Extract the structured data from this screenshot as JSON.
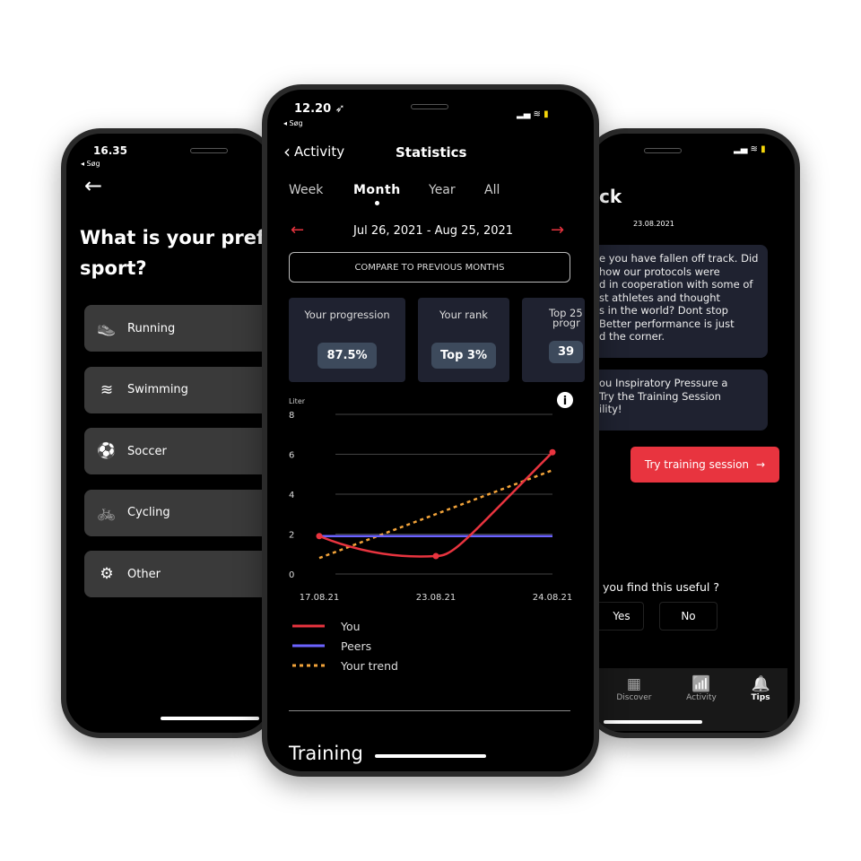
{
  "left_phone": {
    "time": "16.35",
    "back_app": "◂ Søg",
    "title_line1": "What is your pref",
    "title_line2": "sport?",
    "sports": [
      {
        "label": "Running",
        "icon": "running-shoe-icon",
        "glyph": "👟"
      },
      {
        "label": "Swimming",
        "icon": "swimmer-icon",
        "glyph": "≋"
      },
      {
        "label": "Soccer",
        "icon": "soccer-ball-icon",
        "glyph": "⚽"
      },
      {
        "label": "Cycling",
        "icon": "bicycle-icon",
        "glyph": "🚲"
      },
      {
        "label": "Other",
        "icon": "other-sports-icon",
        "glyph": "⚙"
      }
    ]
  },
  "center_phone": {
    "time": "12.20",
    "back_app": "◂ Søg",
    "back_label": "Activity",
    "title": "Statistics",
    "tabs": [
      {
        "label": "Week"
      },
      {
        "label": "Month",
        "active": true
      },
      {
        "label": "Year"
      },
      {
        "label": "All"
      }
    ],
    "date_range": "Jul 26, 2021 - Aug 25, 2021",
    "compare_button": "COMPARE TO PREVIOUS MONTHS",
    "cards": [
      {
        "label": "Your progression",
        "value": "87.5%"
      },
      {
        "label": "Your rank",
        "value": "Top 3%"
      },
      {
        "label": "Top 25",
        "label2": "progr",
        "value": "39"
      }
    ],
    "section_title": "Training",
    "accent": "#e8343f"
  },
  "chart_data": {
    "type": "line",
    "ylabel": "Liter",
    "ylim": [
      0,
      8
    ],
    "yticks": [
      "0",
      "2",
      "4",
      "6",
      "8"
    ],
    "categories": [
      "17.08.21",
      "23.08.21",
      "24.08.21"
    ],
    "grid": true,
    "legend_placement": "bottom",
    "series": [
      {
        "name": "You",
        "values": [
          1.9,
          0.9,
          6.1
        ],
        "color": "#e8343f"
      },
      {
        "name": "Peers",
        "values": [
          1.9,
          1.9,
          1.9
        ],
        "color": "#6b63ff"
      },
      {
        "name": "Your trend",
        "values": [
          0.8,
          3.0,
          5.2
        ],
        "color": "#f2a33a",
        "dashed": true
      }
    ]
  },
  "right_phone": {
    "title": "ck",
    "date": "23.08.2021",
    "message1": [
      "e you have fallen off track. Did",
      "how our protocols were",
      "d in cooperation with some of",
      "st athletes and thought",
      "s in the world? Dont stop",
      "Better performance is just",
      "d the corner."
    ],
    "message2": [
      "ou Inspiratory Pressure a",
      "Try the Training Session",
      "ility!"
    ],
    "cta": "Try training session",
    "question": "you find this useful ?",
    "yes": "Yes",
    "no": "No",
    "nav": [
      {
        "label": "Discover",
        "icon": "grid-icon"
      },
      {
        "label": "Activity",
        "icon": "bar-chart-icon"
      },
      {
        "label": "Tips",
        "icon": "bell-icon",
        "active": true
      }
    ]
  }
}
